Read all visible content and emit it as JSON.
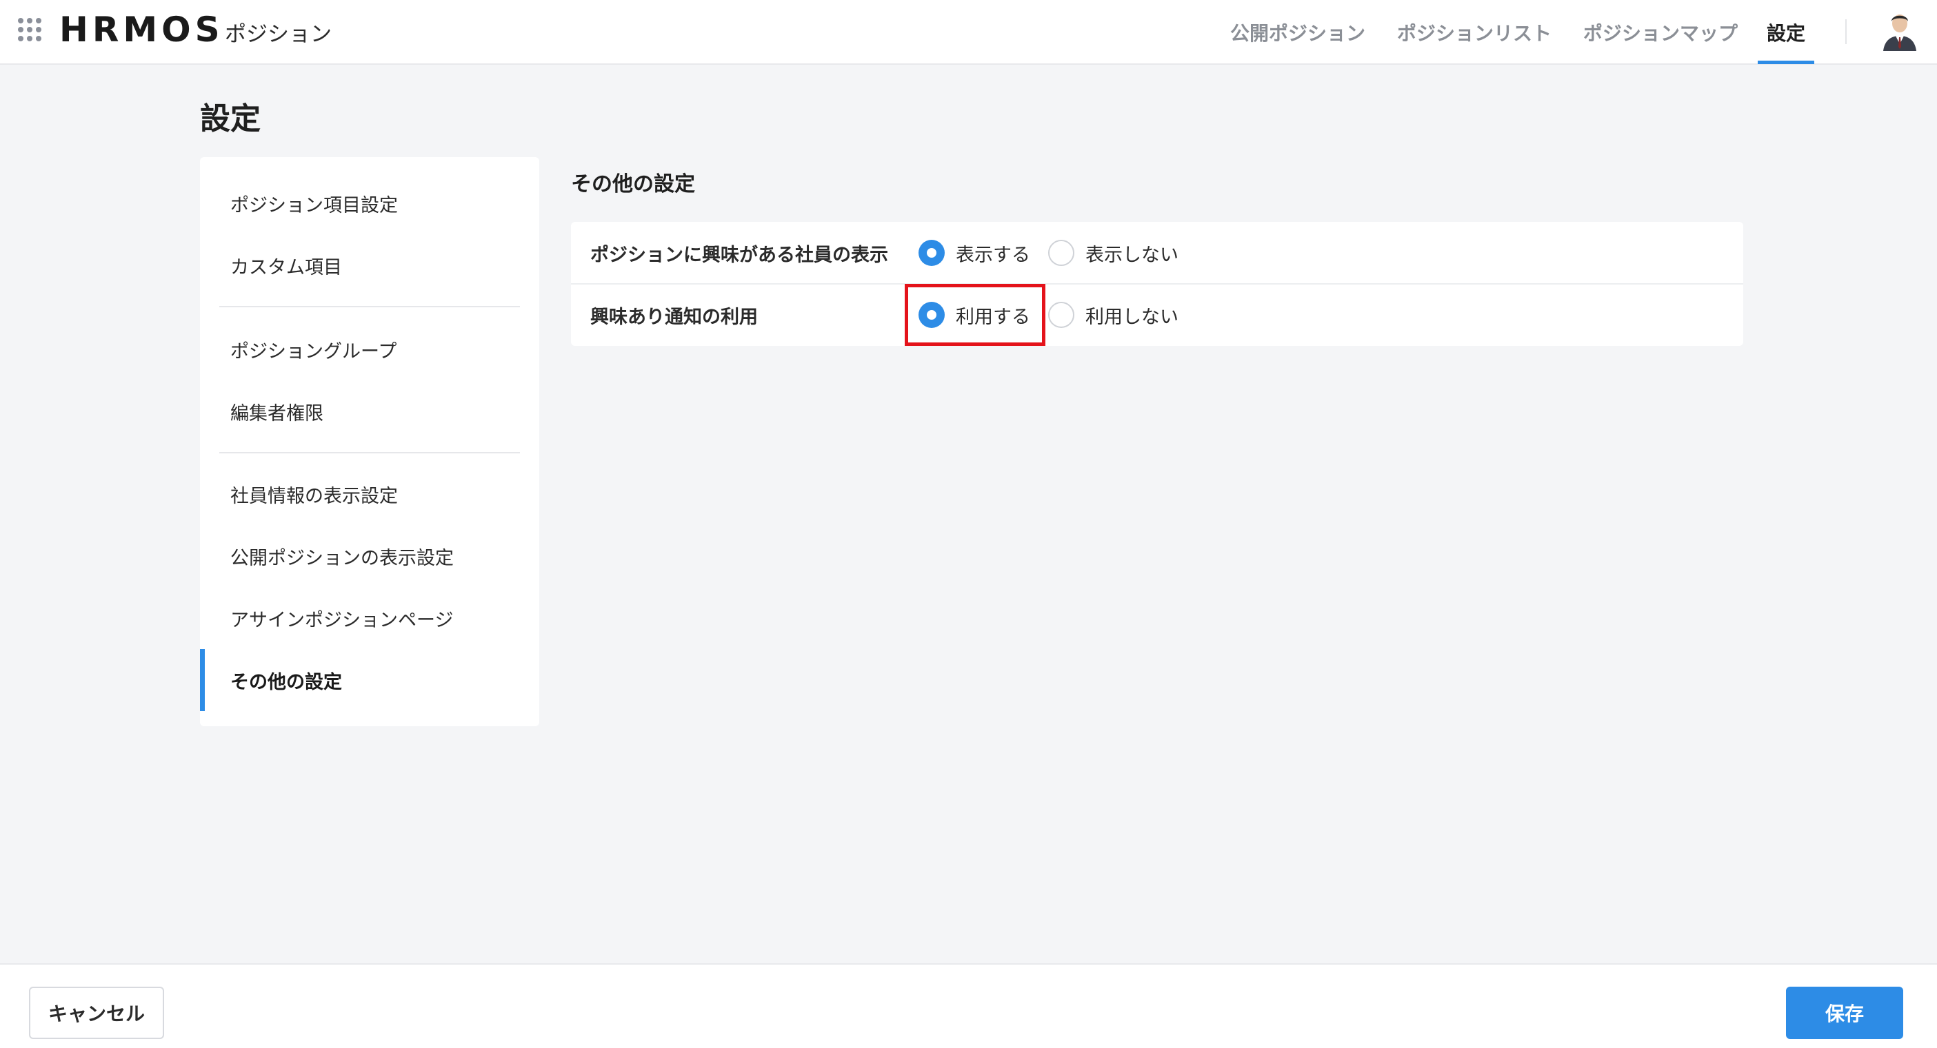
{
  "header": {
    "logo": "HRMOS",
    "product": "ポジション",
    "nav": [
      {
        "label": "公開ポジション",
        "active": false
      },
      {
        "label": "ポジションリスト",
        "active": false
      },
      {
        "label": "ポジションマップ",
        "active": false
      },
      {
        "label": "設定",
        "active": true
      }
    ],
    "icons": {
      "app_switcher": "grid-icon",
      "user": "avatar"
    }
  },
  "page": {
    "title": "設定"
  },
  "sidebar": {
    "items": [
      {
        "label": "ポジション項目設定"
      },
      {
        "label": "カスタム項目"
      },
      {
        "label": "ポジショングループ"
      },
      {
        "label": "編集者権限"
      },
      {
        "label": "社員情報の表示設定"
      },
      {
        "label": "公開ポジションの表示設定"
      },
      {
        "label": "アサインポジションページ"
      },
      {
        "label": "その他の設定"
      }
    ],
    "active_item": "その他の設定"
  },
  "main": {
    "section_title": "その他の設定",
    "settings": [
      {
        "label": "ポジションに興味がある社員の表示",
        "options": [
          {
            "label": "表示する",
            "checked": true
          },
          {
            "label": "表示しない",
            "checked": false
          }
        ]
      },
      {
        "label": "興味あり通知の利用",
        "options": [
          {
            "label": "利用する",
            "checked": true
          },
          {
            "label": "利用しない",
            "checked": false
          }
        ]
      }
    ]
  },
  "footer": {
    "cancel_label": "キャンセル",
    "save_label": "保存"
  },
  "colors": {
    "accent": "#2d8ce6",
    "highlight": "#e4131b",
    "background": "#f4f5f7"
  }
}
